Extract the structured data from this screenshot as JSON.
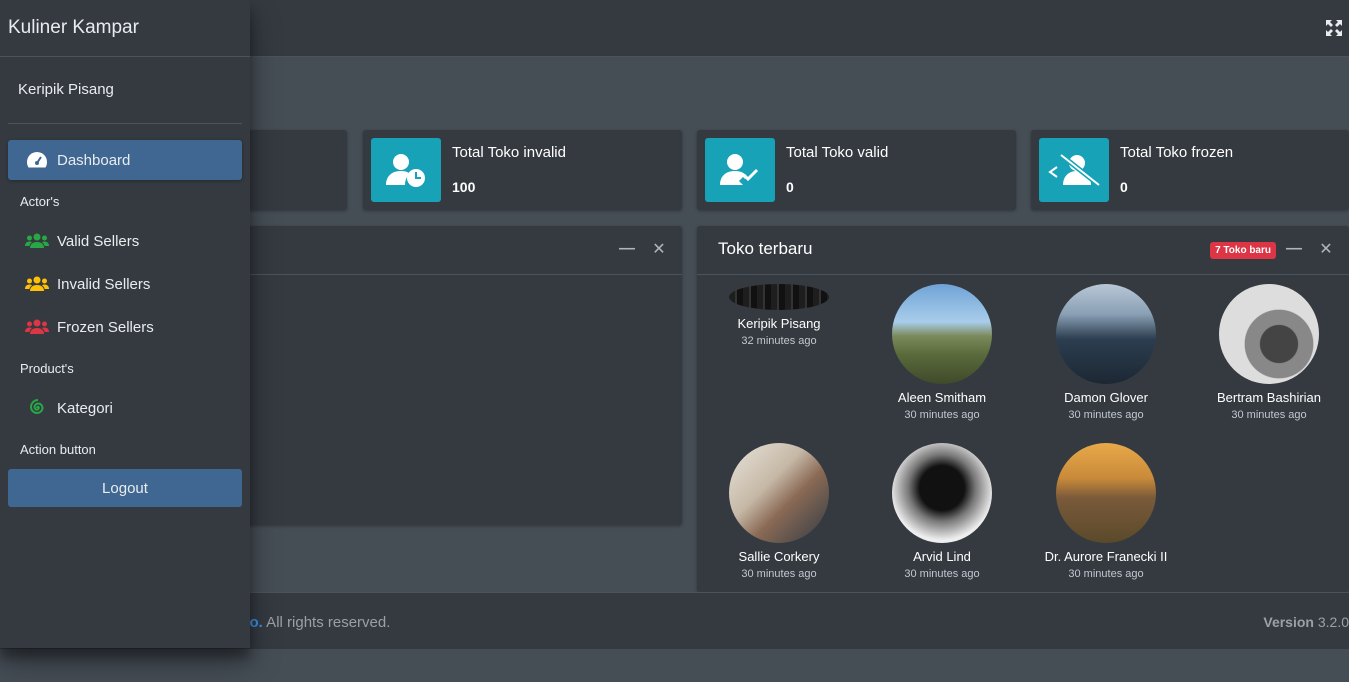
{
  "sidebar": {
    "brand": "Kuliner Kampar",
    "user_name": "Keripik Pisang",
    "items": [
      {
        "label": "Dashboard",
        "icon": "tachometer-icon",
        "color": "#ffffff"
      },
      {
        "label": "Valid Sellers",
        "icon": "users-icon",
        "color": "#28a745"
      },
      {
        "label": "Invalid Sellers",
        "icon": "users-icon",
        "color": "#ffc107"
      },
      {
        "label": "Frozen Sellers",
        "icon": "users-icon",
        "color": "#dc3545"
      },
      {
        "label": "Kategori",
        "icon": "spiral-icon",
        "color": "#28a745"
      }
    ],
    "headers": {
      "actors": "Actor's",
      "products": "Product's",
      "action": "Action button"
    },
    "logout_label": "Logout"
  },
  "info_boxes": [
    {
      "label": "Total Toko invalid",
      "value": "100",
      "icon": "user-clock-icon"
    },
    {
      "label": "Total Toko valid",
      "value": "0",
      "icon": "user-check-icon"
    },
    {
      "label": "Total Toko frozen",
      "value": "0",
      "icon": "user-slash-icon"
    }
  ],
  "latest_card": {
    "title": "Toko terbaru",
    "badge": "7 Toko baru",
    "users": [
      {
        "name": "Keripik Pisang",
        "time": "32 minutes ago"
      },
      {
        "name": "Aleen Smitham",
        "time": "30 minutes ago"
      },
      {
        "name": "Damon Glover",
        "time": "30 minutes ago"
      },
      {
        "name": "Bertram Bashirian",
        "time": "30 minutes ago"
      },
      {
        "name": "Sallie Corkery",
        "time": "30 minutes ago"
      },
      {
        "name": "Arvid Lind",
        "time": "30 minutes ago"
      },
      {
        "name": "Dr. Aurore Franecki II",
        "time": "30 minutes ago"
      }
    ]
  },
  "footer": {
    "brand": "TE.io.",
    "rights": " All rights reserved.",
    "version_label": "Version",
    "version": "3.2.0"
  },
  "colors": {
    "accent": "#3f6791",
    "info": "#17a2b8",
    "badge": "#dc3545"
  }
}
